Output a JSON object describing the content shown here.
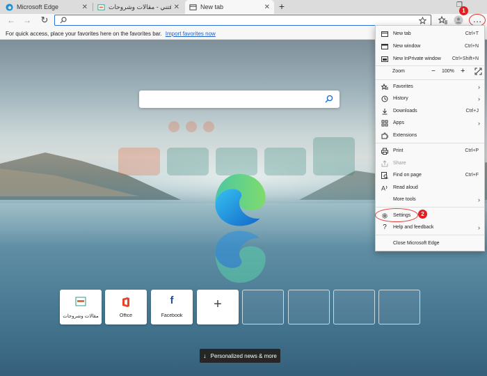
{
  "tabs": [
    {
      "title": "Microsoft Edge"
    },
    {
      "title": "افتني - مقالات وشروحات"
    },
    {
      "title": "New tab"
    }
  ],
  "toolbar": {
    "address_value": "",
    "new_tab_symbol": "+",
    "more_symbol": "…"
  },
  "favorites_bar": {
    "text": "For quick access, place your favorites here on the favorites bar.",
    "link": "Import favorites now"
  },
  "newtab": {
    "search_placeholder": "",
    "tiles": [
      {
        "label": "مقالات وشروحات"
      },
      {
        "label": "Office"
      },
      {
        "label": "Facebook"
      },
      {
        "label": ""
      }
    ],
    "news_button": "Personalized news & more"
  },
  "menu": {
    "items": [
      {
        "label": "New tab",
        "shortcut": "Ctrl+T"
      },
      {
        "label": "New window",
        "shortcut": "Ctrl+N"
      },
      {
        "label": "New InPrivate window",
        "shortcut": "Ctrl+Shift+N"
      },
      {
        "label": "Favorites",
        "shortcut": ""
      },
      {
        "label": "History",
        "shortcut": ""
      },
      {
        "label": "Downloads",
        "shortcut": "Ctrl+J"
      },
      {
        "label": "Apps",
        "shortcut": ""
      },
      {
        "label": "Extensions",
        "shortcut": ""
      },
      {
        "label": "Print",
        "shortcut": "Ctrl+P"
      },
      {
        "label": "Share",
        "shortcut": ""
      },
      {
        "label": "Find on page",
        "shortcut": "Ctrl+F"
      },
      {
        "label": "Read aloud",
        "shortcut": ""
      },
      {
        "label": "More tools",
        "shortcut": ""
      },
      {
        "label": "Settings",
        "shortcut": ""
      },
      {
        "label": "Help and feedback",
        "shortcut": ""
      },
      {
        "label": "Close Microsoft Edge",
        "shortcut": ""
      }
    ],
    "zoom": {
      "label": "Zoom",
      "minus": "−",
      "value": "100%",
      "plus": "+"
    }
  },
  "annotations": {
    "badge1": "1",
    "badge2": "2"
  },
  "colors": {
    "accent": "#2f6fde",
    "highlight": "#e23b3b",
    "badge": "#e02020",
    "menu_bg": "#f9f9f9"
  }
}
